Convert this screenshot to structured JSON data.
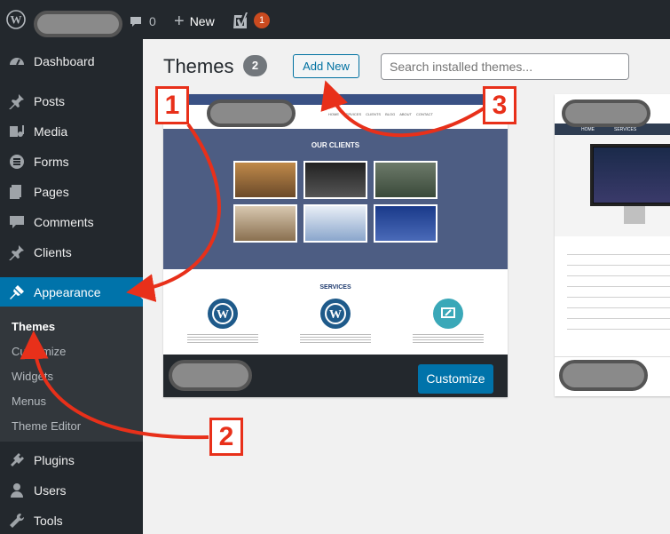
{
  "adminbar": {
    "comment_count": "0",
    "new_label": "New",
    "notification_count": "1"
  },
  "sidebar": {
    "items": [
      {
        "label": "Dashboard",
        "icon": "dashboard-icon"
      },
      {
        "label": "Posts",
        "icon": "pin-icon"
      },
      {
        "label": "Media",
        "icon": "media-icon"
      },
      {
        "label": "Forms",
        "icon": "forms-icon"
      },
      {
        "label": "Pages",
        "icon": "pages-icon"
      },
      {
        "label": "Comments",
        "icon": "comment-icon"
      },
      {
        "label": "Clients",
        "icon": "pin-icon"
      },
      {
        "label": "Appearance",
        "icon": "brush-icon"
      }
    ],
    "submenu": [
      "Themes",
      "Customize",
      "Widgets",
      "Menus",
      "Theme Editor"
    ],
    "items_after": [
      {
        "label": "Plugins",
        "icon": "plugin-icon"
      },
      {
        "label": "Users",
        "icon": "user-icon"
      },
      {
        "label": "Tools",
        "icon": "wrench-icon"
      }
    ]
  },
  "main": {
    "title": "Themes",
    "theme_count": "2",
    "add_new_label": "Add New",
    "search_placeholder": "Search installed themes...",
    "customize_label": "Customize"
  },
  "theme1_preview": {
    "nav": [
      "HOME",
      "SERVICES",
      "CLIENTS",
      "BLOG",
      "ABOUT",
      "CONTACT"
    ],
    "hero_title": "OUR CLIENTS",
    "services_title": "SERVICES"
  },
  "theme2_preview": {
    "nav": [
      "HOME",
      "SERVICES"
    ]
  },
  "annotations": {
    "step1": "1",
    "step2": "2",
    "step3": "3",
    "color": "#e8301a"
  },
  "colors": {
    "adminbar": "#23282d",
    "active_menu": "#0073aa",
    "submenu_bg": "#32373c",
    "content_bg": "#f1f1f1"
  }
}
